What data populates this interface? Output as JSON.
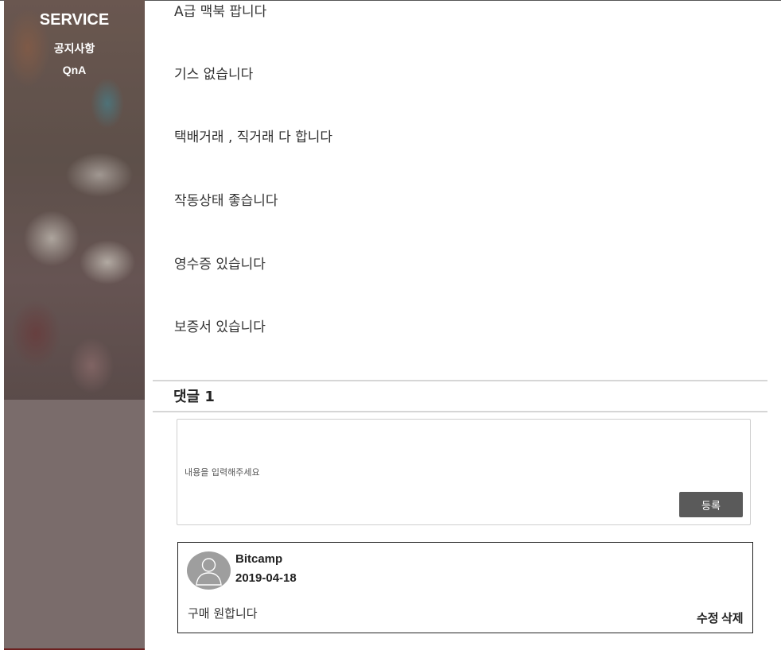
{
  "sidebar": {
    "title": "SERVICE",
    "links": [
      "공지사항",
      "QnA"
    ]
  },
  "post": {
    "lines": [
      "A급 맥북 팝니다",
      "기스 없습니다",
      "택배거래 , 직거래 다 합니다",
      "작동상태 좋습니다",
      "영수증 있습니다",
      "보증서 있습니다"
    ]
  },
  "comments": {
    "heading": "댓글 1",
    "input_placeholder": "내용을 입력해주세요",
    "submit_label": "등록",
    "items": [
      {
        "author": "Bitcamp",
        "date": "2019-04-18",
        "text": "구매 원합니다",
        "edit_label": "수정",
        "delete_label": "삭제"
      }
    ]
  },
  "colors": {
    "sidebar_bg": "#7a6c6b",
    "submit_bg": "#5a5a5a"
  }
}
